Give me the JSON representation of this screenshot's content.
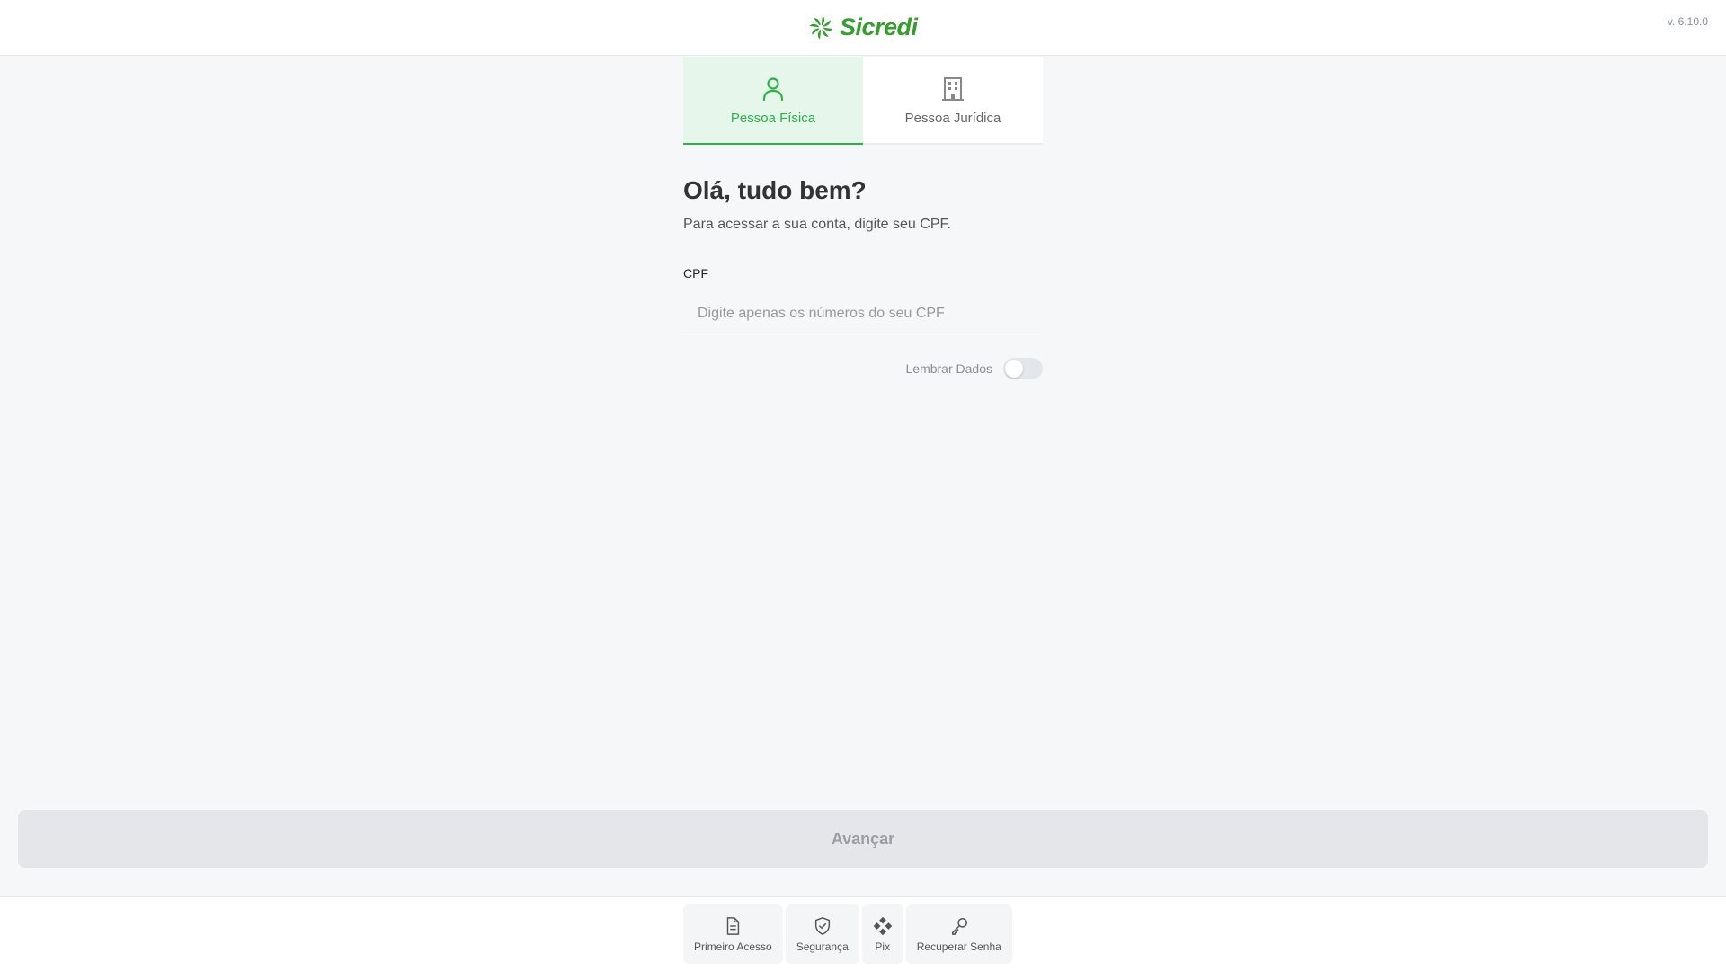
{
  "header": {
    "brand": "Sicredi",
    "version": "v. 6.10.0"
  },
  "tabs": [
    {
      "label": "Pessoa Física",
      "active": true,
      "icon": "person-icon"
    },
    {
      "label": "Pessoa Jurídica",
      "active": false,
      "icon": "building-icon"
    }
  ],
  "form": {
    "greeting": "Olá, tudo bem?",
    "subtitle": "Para acessar a sua conta, digite seu CPF.",
    "cpf_label": "CPF",
    "cpf_placeholder": "Digite apenas os números do seu CPF",
    "cpf_value": "",
    "remember_label": "Lembrar Dados",
    "remember_on": false
  },
  "actions": {
    "advance_label": "Avançar"
  },
  "footer": {
    "items": [
      {
        "label": "Primeiro Acesso",
        "icon": "document-icon"
      },
      {
        "label": "Segurança",
        "icon": "shield-check-icon"
      },
      {
        "label": "Pix",
        "icon": "pix-icon"
      },
      {
        "label": "Recuperar Senha",
        "icon": "key-icon"
      }
    ]
  },
  "colors": {
    "brand_green": "#33a02c",
    "active_tab_green": "#2bb34a",
    "active_tab_bg": "#e7f6ea",
    "disabled_button_bg": "#e4e6e9"
  }
}
